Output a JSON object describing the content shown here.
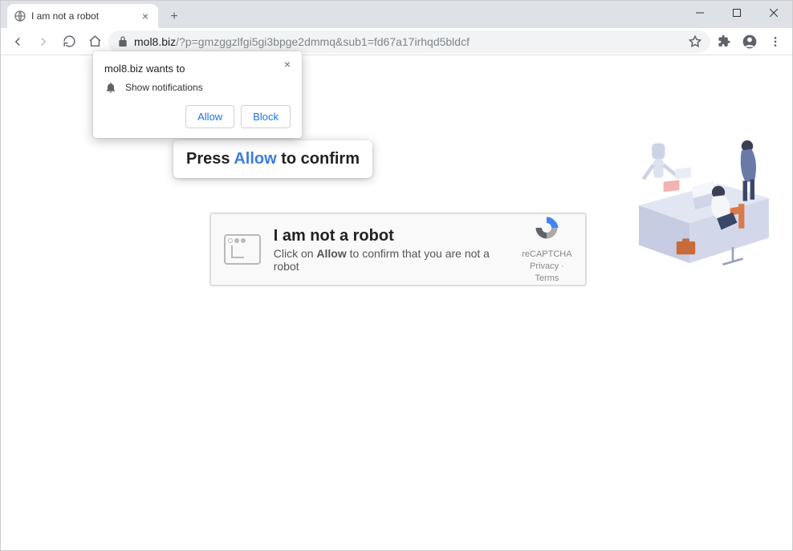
{
  "tab": {
    "title": "I am not a robot"
  },
  "address": {
    "host": "mol8.biz",
    "path": "/?p=gmzggzlfgi5gi3bpge2dmmq&sub1=fd67a17irhqd5bldcf"
  },
  "permission": {
    "title": "mol8.biz wants to",
    "option": "Show notifications",
    "allow": "Allow",
    "block": "Block"
  },
  "banner": {
    "pre": "Press ",
    "allow": "Allow",
    "post": " to confirm"
  },
  "captcha": {
    "heading": "I am not a robot",
    "line_pre": "Click on ",
    "line_b": "Allow",
    "line_post": " to confirm that you are not a robot",
    "brand": "reCAPTCHA",
    "links": "Privacy · Terms"
  }
}
